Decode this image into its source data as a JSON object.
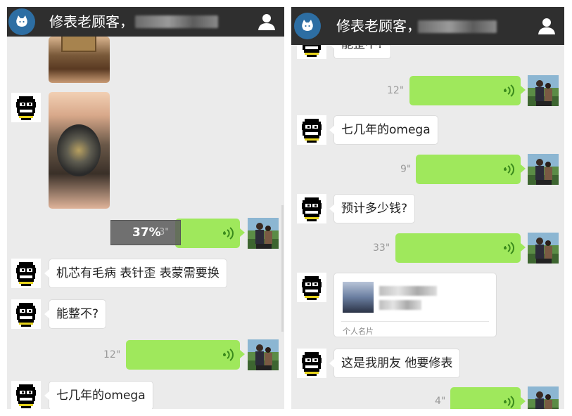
{
  "header": {
    "title": "修表老顾客，"
  },
  "left": {
    "upload_progress": "37%",
    "upload_duration_hint": "3\"",
    "messages": [
      {
        "type": "text",
        "from": "contact",
        "text": "机芯有毛病 表针歪 表蒙需要换"
      },
      {
        "type": "text",
        "from": "contact",
        "text": "能整不?"
      },
      {
        "type": "voice",
        "from": "me",
        "duration": "12\""
      },
      {
        "type": "text",
        "from": "contact",
        "text": "七几年的omega"
      }
    ]
  },
  "right": {
    "top_partial_text": "能整不?",
    "messages": [
      {
        "type": "voice",
        "from": "me",
        "duration": "12\""
      },
      {
        "type": "text",
        "from": "contact",
        "text": "七几年的omega"
      },
      {
        "type": "voice",
        "from": "me",
        "duration": "9\""
      },
      {
        "type": "text",
        "from": "contact",
        "text": "预计多少钱?"
      },
      {
        "type": "voice",
        "from": "me",
        "duration": "33\""
      },
      {
        "type": "card",
        "from": "contact",
        "label": "个人名片"
      },
      {
        "type": "text",
        "from": "contact",
        "text": "这是我朋友 他要修表"
      },
      {
        "type": "voice",
        "from": "me",
        "duration": "4\""
      }
    ]
  },
  "icons": {
    "app_logo": "cat-logo-icon",
    "contact_info": "user-icon",
    "voice": "voice-wave-icon"
  },
  "colors": {
    "header_bg": "#2f2f2f",
    "chat_bg": "#ebebeb",
    "sent_bubble": "#9fe85c",
    "received_bubble": "#ffffff",
    "logo_bg": "#2d6ea3"
  }
}
